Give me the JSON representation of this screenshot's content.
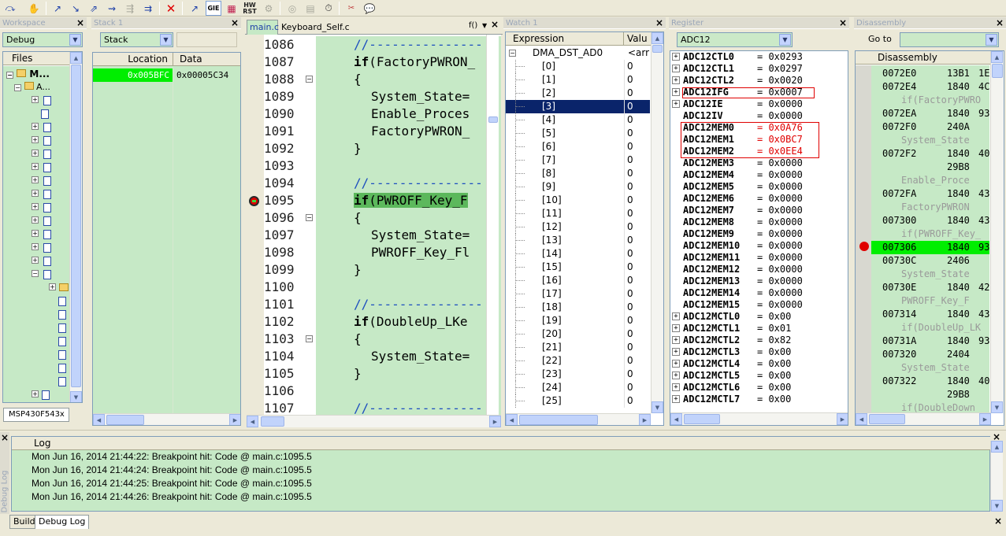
{
  "toolbar": {
    "gie_label": "GIE",
    "rst_label": "HW RST",
    "icons": [
      "step-over-icon",
      "stop-hand-icon",
      "step-into-icon",
      "step-out-icon",
      "next-statement-icon",
      "run-to-cursor-icon",
      "go-icon",
      "break-icon",
      "reset-icon",
      "gie-icon",
      "break-icon-2",
      "hw-reset-icon",
      "wait-icon",
      "memory-icon",
      "register-icon",
      "breakpoint-icon",
      "clear-icon",
      "comment-icon"
    ]
  },
  "workspace": {
    "title": "Workspace",
    "config": "Debug",
    "files_header": "Files",
    "project": "M...",
    "group_a": "A...",
    "group_b": "A...",
    "tab": "MSP430F543x"
  },
  "stack": {
    "title": "Stack 1",
    "combo": "Stack",
    "col_location": "Location",
    "col_data": "Data",
    "rows": [
      {
        "location": "0x005BFC",
        "data": "0x00005C34"
      }
    ]
  },
  "editor": {
    "tabs": [
      "main.c",
      "Keyboard_Self.c"
    ],
    "func_combo": "f()",
    "lines": [
      {
        "num": "1086",
        "text": "//---------------",
        "kind": "comment"
      },
      {
        "num": "1087",
        "text": "if(FactoryPWRON_",
        "kind": "kw"
      },
      {
        "num": "1088",
        "text": "{",
        "kind": "brace"
      },
      {
        "num": "1089",
        "text": "System_State=",
        "kind": "stmt"
      },
      {
        "num": "1090",
        "text": "Enable_Proces",
        "kind": "stmt"
      },
      {
        "num": "1091",
        "text": "FactoryPWRON_",
        "kind": "stmt"
      },
      {
        "num": "1092",
        "text": "}",
        "kind": "brace"
      },
      {
        "num": "1093",
        "text": "",
        "kind": "blank"
      },
      {
        "num": "1094",
        "text": "//---------------",
        "kind": "comment"
      },
      {
        "num": "1095",
        "text": "if(PWROFF_Key_F",
        "kind": "kw_hl"
      },
      {
        "num": "1096",
        "text": "{",
        "kind": "brace"
      },
      {
        "num": "1097",
        "text": "System_State=",
        "kind": "stmt"
      },
      {
        "num": "1098",
        "text": "PWROFF_Key_Fl",
        "kind": "stmt"
      },
      {
        "num": "1099",
        "text": "}",
        "kind": "brace"
      },
      {
        "num": "1100",
        "text": "",
        "kind": "blank"
      },
      {
        "num": "1101",
        "text": "//---------------",
        "kind": "comment"
      },
      {
        "num": "1102",
        "text": "if(DoubleUp_LKe",
        "kind": "kw"
      },
      {
        "num": "1103",
        "text": "{",
        "kind": "brace"
      },
      {
        "num": "1104",
        "text": "System_State=",
        "kind": "stmt"
      },
      {
        "num": "1105",
        "text": "}",
        "kind": "brace"
      },
      {
        "num": "1106",
        "text": "",
        "kind": "blank"
      },
      {
        "num": "1107",
        "text": "//---------------",
        "kind": "comment"
      }
    ]
  },
  "watch": {
    "title": "Watch 1",
    "col_expression": "Expression",
    "col_value": "Valu",
    "root_name": "DMA_DST_AD0",
    "root_value": "<arr",
    "items": [
      {
        "name": "[0]",
        "value": "0"
      },
      {
        "name": "[1]",
        "value": "0"
      },
      {
        "name": "[2]",
        "value": "0"
      },
      {
        "name": "[3]",
        "value": "0"
      },
      {
        "name": "[4]",
        "value": "0"
      },
      {
        "name": "[5]",
        "value": "0"
      },
      {
        "name": "[6]",
        "value": "0"
      },
      {
        "name": "[7]",
        "value": "0"
      },
      {
        "name": "[8]",
        "value": "0"
      },
      {
        "name": "[9]",
        "value": "0"
      },
      {
        "name": "[10]",
        "value": "0"
      },
      {
        "name": "[11]",
        "value": "0"
      },
      {
        "name": "[12]",
        "value": "0"
      },
      {
        "name": "[13]",
        "value": "0"
      },
      {
        "name": "[14]",
        "value": "0"
      },
      {
        "name": "[15]",
        "value": "0"
      },
      {
        "name": "[16]",
        "value": "0"
      },
      {
        "name": "[17]",
        "value": "0"
      },
      {
        "name": "[18]",
        "value": "0"
      },
      {
        "name": "[19]",
        "value": "0"
      },
      {
        "name": "[20]",
        "value": "0"
      },
      {
        "name": "[21]",
        "value": "0"
      },
      {
        "name": "[22]",
        "value": "0"
      },
      {
        "name": "[23]",
        "value": "0"
      },
      {
        "name": "[24]",
        "value": "0"
      },
      {
        "name": "[25]",
        "value": "0"
      }
    ]
  },
  "register": {
    "title": "Register",
    "combo": "ADC12",
    "rows": [
      {
        "name": "ADC12CTL0",
        "value": "= 0x0293",
        "expand": true
      },
      {
        "name": "ADC12CTL1",
        "value": "= 0x0297",
        "expand": true
      },
      {
        "name": "ADC12CTL2",
        "value": "= 0x0020",
        "expand": true
      },
      {
        "name": "ADC12IFG",
        "value": "= 0x0007",
        "expand": true
      },
      {
        "name": "ADC12IE",
        "value": "= 0x0000",
        "expand": true
      },
      {
        "name": "ADC12IV",
        "value": "= 0x0000",
        "expand": false
      },
      {
        "name": "ADC12MEM0",
        "value": "= 0x0A76",
        "expand": false
      },
      {
        "name": "ADC12MEM1",
        "value": "= 0x0BC7",
        "expand": false
      },
      {
        "name": "ADC12MEM2",
        "value": "= 0x0EE4",
        "expand": false
      },
      {
        "name": "ADC12MEM3",
        "value": "= 0x0000",
        "expand": false
      },
      {
        "name": "ADC12MEM4",
        "value": "= 0x0000",
        "expand": false
      },
      {
        "name": "ADC12MEM5",
        "value": "= 0x0000",
        "expand": false
      },
      {
        "name": "ADC12MEM6",
        "value": "= 0x0000",
        "expand": false
      },
      {
        "name": "ADC12MEM7",
        "value": "= 0x0000",
        "expand": false
      },
      {
        "name": "ADC12MEM8",
        "value": "= 0x0000",
        "expand": false
      },
      {
        "name": "ADC12MEM9",
        "value": "= 0x0000",
        "expand": false
      },
      {
        "name": "ADC12MEM10",
        "value": "= 0x0000",
        "expand": false
      },
      {
        "name": "ADC12MEM11",
        "value": "= 0x0000",
        "expand": false
      },
      {
        "name": "ADC12MEM12",
        "value": "= 0x0000",
        "expand": false
      },
      {
        "name": "ADC12MEM13",
        "value": "= 0x0000",
        "expand": false
      },
      {
        "name": "ADC12MEM14",
        "value": "= 0x0000",
        "expand": false
      },
      {
        "name": "ADC12MEM15",
        "value": "= 0x0000",
        "expand": false
      },
      {
        "name": "ADC12MCTL0",
        "value": "= 0x00",
        "expand": true
      },
      {
        "name": "ADC12MCTL1",
        "value": "= 0x01",
        "expand": true
      },
      {
        "name": "ADC12MCTL2",
        "value": "= 0x82",
        "expand": true
      },
      {
        "name": "ADC12MCTL3",
        "value": "= 0x00",
        "expand": true
      },
      {
        "name": "ADC12MCTL4",
        "value": "= 0x00",
        "expand": true
      },
      {
        "name": "ADC12MCTL5",
        "value": "= 0x00",
        "expand": true
      },
      {
        "name": "ADC12MCTL6",
        "value": "= 0x00",
        "expand": true
      },
      {
        "name": "ADC12MCTL7",
        "value": "= 0x00",
        "expand": true
      }
    ]
  },
  "disassembly": {
    "title": "Disassembly",
    "goto_label": "Go to",
    "header": "Disassembly",
    "rows": [
      {
        "type": "asm",
        "addr": "0072E0",
        "b1": "13B1",
        "b2": "1E"
      },
      {
        "type": "asm",
        "addr": "0072E4",
        "b1": "1840",
        "b2": "4C"
      },
      {
        "type": "src",
        "text": "if(FactoryPWRO"
      },
      {
        "type": "asm",
        "addr": "0072EA",
        "b1": "1840",
        "b2": "93"
      },
      {
        "type": "asm",
        "addr": "0072F0",
        "b1": "240A",
        "b2": ""
      },
      {
        "type": "src",
        "text": "System_State"
      },
      {
        "type": "asm",
        "addr": "0072F2",
        "b1": "1840",
        "b2": "40"
      },
      {
        "type": "asm",
        "addr": "",
        "b1": "29B8",
        "b2": ""
      },
      {
        "type": "src",
        "text": "Enable_Proce"
      },
      {
        "type": "asm",
        "addr": "0072FA",
        "b1": "1840",
        "b2": "43"
      },
      {
        "type": "src",
        "text": "FactoryPWRON"
      },
      {
        "type": "asm",
        "addr": "007300",
        "b1": "1840",
        "b2": "43"
      },
      {
        "type": "src",
        "text": "if(PWROFF_Key_"
      },
      {
        "type": "asm_hl",
        "addr": "007306",
        "b1": "1840",
        "b2": "93"
      },
      {
        "type": "asm",
        "addr": "00730C",
        "b1": "2406",
        "b2": ""
      },
      {
        "type": "src",
        "text": "System_State"
      },
      {
        "type": "asm",
        "addr": "00730E",
        "b1": "1840",
        "b2": "42"
      },
      {
        "type": "src",
        "text": "PWROFF_Key_F"
      },
      {
        "type": "asm",
        "addr": "007314",
        "b1": "1840",
        "b2": "43"
      },
      {
        "type": "src",
        "text": "if(DoubleUp_LK"
      },
      {
        "type": "asm",
        "addr": "00731A",
        "b1": "1840",
        "b2": "93"
      },
      {
        "type": "asm",
        "addr": "007320",
        "b1": "2404",
        "b2": ""
      },
      {
        "type": "src",
        "text": "System_State"
      },
      {
        "type": "asm",
        "addr": "007322",
        "b1": "1840",
        "b2": "40"
      },
      {
        "type": "asm",
        "addr": "",
        "b1": "29B8",
        "b2": ""
      },
      {
        "type": "src",
        "text": "if(DoubleDown"
      }
    ]
  },
  "log": {
    "side_title": "Debug Log",
    "header": "Log",
    "lines": [
      "Mon Jun 16, 2014 21:44:22: Breakpoint hit: Code @ main.c:1095.5",
      "Mon Jun 16, 2014 21:44:24: Breakpoint hit: Code @ main.c:1095.5",
      "Mon Jun 16, 2014 21:44:25: Breakpoint hit: Code @ main.c:1095.5",
      "Mon Jun 16, 2014 21:44:26: Breakpoint hit: Code @ main.c:1095.5"
    ],
    "tabs": [
      "Build",
      "Debug Log"
    ]
  },
  "colors": {
    "pane_green": "#c6e9c6",
    "highlight_green": "#00ee00",
    "selection_navy": "#0a246a",
    "breakpoint_red": "#e00000"
  }
}
